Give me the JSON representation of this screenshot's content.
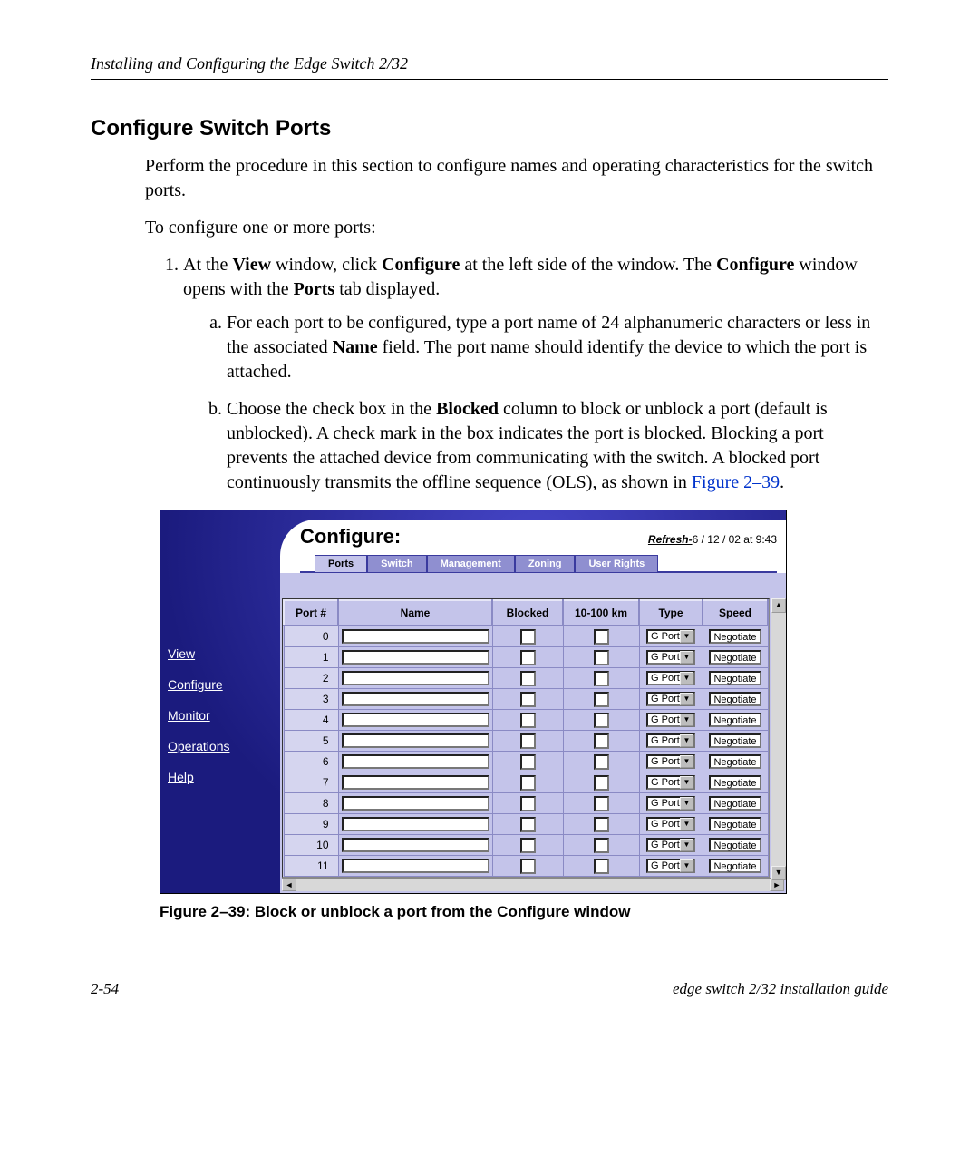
{
  "header": {
    "running": "Installing and Configuring the Edge Switch 2/32"
  },
  "section": {
    "title": "Configure Switch Ports",
    "intro": "Perform the procedure in this section to configure names and operating characteristics for the switch ports.",
    "lead": "To configure one or more ports:",
    "step1_a": "At the ",
    "step1_b": "View",
    "step1_c": " window, click ",
    "step1_d": "Configure",
    "step1_e": " at the left side of the window. The ",
    "step1_f": "Configure",
    "step1_g": " window opens with the ",
    "step1_h": "Ports",
    "step1_i": " tab displayed.",
    "sub_a_1": "For each port to be configured, type a port name of 24 alphanumeric characters or less in the associated ",
    "sub_a_2": "Name",
    "sub_a_3": " field. The port name should identify the device to which the port is attached.",
    "sub_b_1": "Choose the check box in the ",
    "sub_b_2": "Blocked",
    "sub_b_3": " column to block or unblock a port (default is unblocked). A check mark in the box indicates the port is blocked. Blocking a port prevents the attached device from communicating with the switch. A blocked port continuously transmits the offline sequence (OLS), as shown in ",
    "sub_b_ref": "Figure 2–39",
    "sub_b_4": "."
  },
  "figure": {
    "caption": "Figure 2–39:  Block or unblock a port from the Configure window"
  },
  "shot": {
    "panel_title": "Configure:",
    "refresh_label": "Refresh-",
    "refresh_time": "6 / 12 / 02 at 9:43",
    "nav": [
      "View",
      "Configure",
      "Monitor",
      "Operations",
      "Help"
    ],
    "tabs": [
      "Ports",
      "Switch",
      "Management",
      "Zoning",
      "User Rights"
    ],
    "active_tab": 0,
    "columns": [
      "Port #",
      "Name",
      "Blocked",
      "10-100 km",
      "Type",
      "Speed"
    ],
    "type_value": "G Port",
    "speed_value": "Negotiate",
    "rows": [
      0,
      1,
      2,
      3,
      4,
      5,
      6,
      7,
      8,
      9,
      10,
      11
    ]
  },
  "footer": {
    "left": "2-54",
    "right": "edge switch 2/32 installation guide"
  }
}
